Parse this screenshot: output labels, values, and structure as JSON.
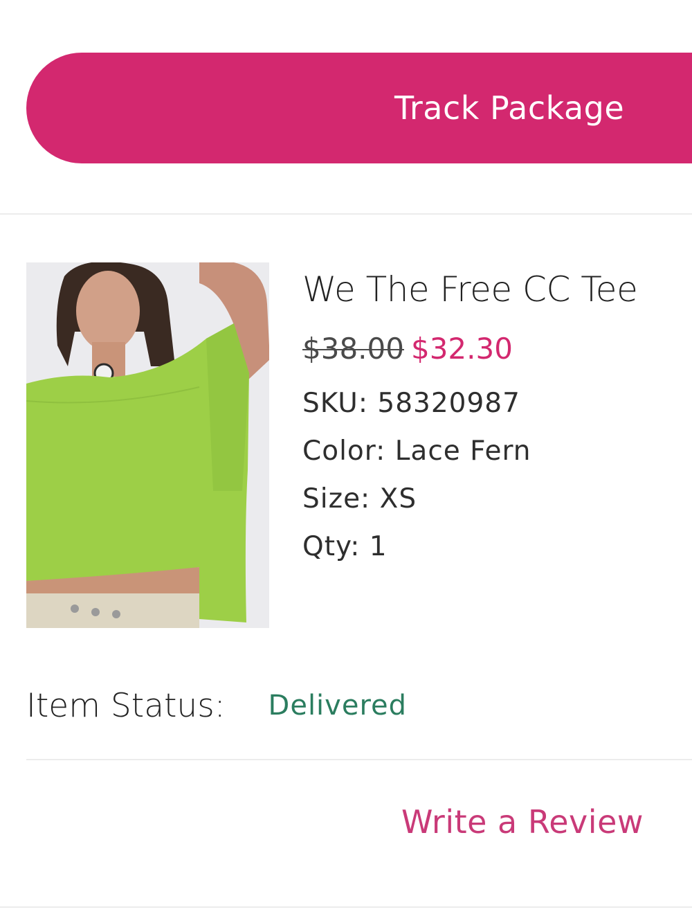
{
  "actions": {
    "track_package_label": "Track Package",
    "write_review_label": "Write a Review"
  },
  "product": {
    "name": "We The Free CC Tee",
    "original_price": "$38.00",
    "sale_price": "$32.30",
    "sku_label": "SKU:",
    "sku": "58320987",
    "color_label": "Color:",
    "color": "Lace Fern",
    "size_label": "Size:",
    "size": "XS",
    "qty_label": "Qty:",
    "qty": "1",
    "image_alt": "product-photo"
  },
  "status": {
    "label": "Item Status:",
    "value": "Delivered"
  },
  "colors": {
    "accent": "#d3286f",
    "status_green": "#2b7d5f",
    "review_link": "#c93a78"
  }
}
